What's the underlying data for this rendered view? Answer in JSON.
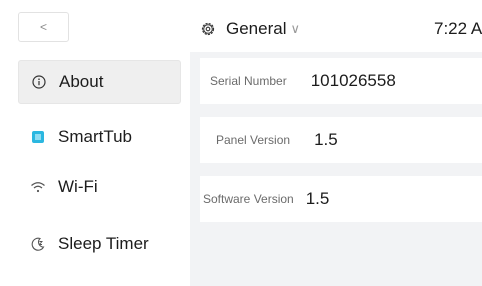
{
  "header": {
    "back_label": "<",
    "title": "General",
    "title_chevron": "∨",
    "time": "7:22 A"
  },
  "sidebar": {
    "items": [
      {
        "label": "About",
        "icon": "info-icon",
        "active": true
      },
      {
        "label": "SmartTub",
        "icon": "smarttub-icon",
        "active": false
      },
      {
        "label": "Wi-Fi",
        "icon": "wifi-icon",
        "active": false
      },
      {
        "label": "Sleep Timer",
        "icon": "moon-icon",
        "active": false
      }
    ]
  },
  "info": [
    {
      "label": "Serial Number",
      "value": "101026558"
    },
    {
      "label": "Panel Version",
      "value": "1.5"
    },
    {
      "label": "Software Version",
      "value": "1.5"
    }
  ],
  "colors": {
    "accent": "#2bb7e0",
    "panel_bg": "#f2f3f5",
    "active_bg": "#efefef"
  }
}
